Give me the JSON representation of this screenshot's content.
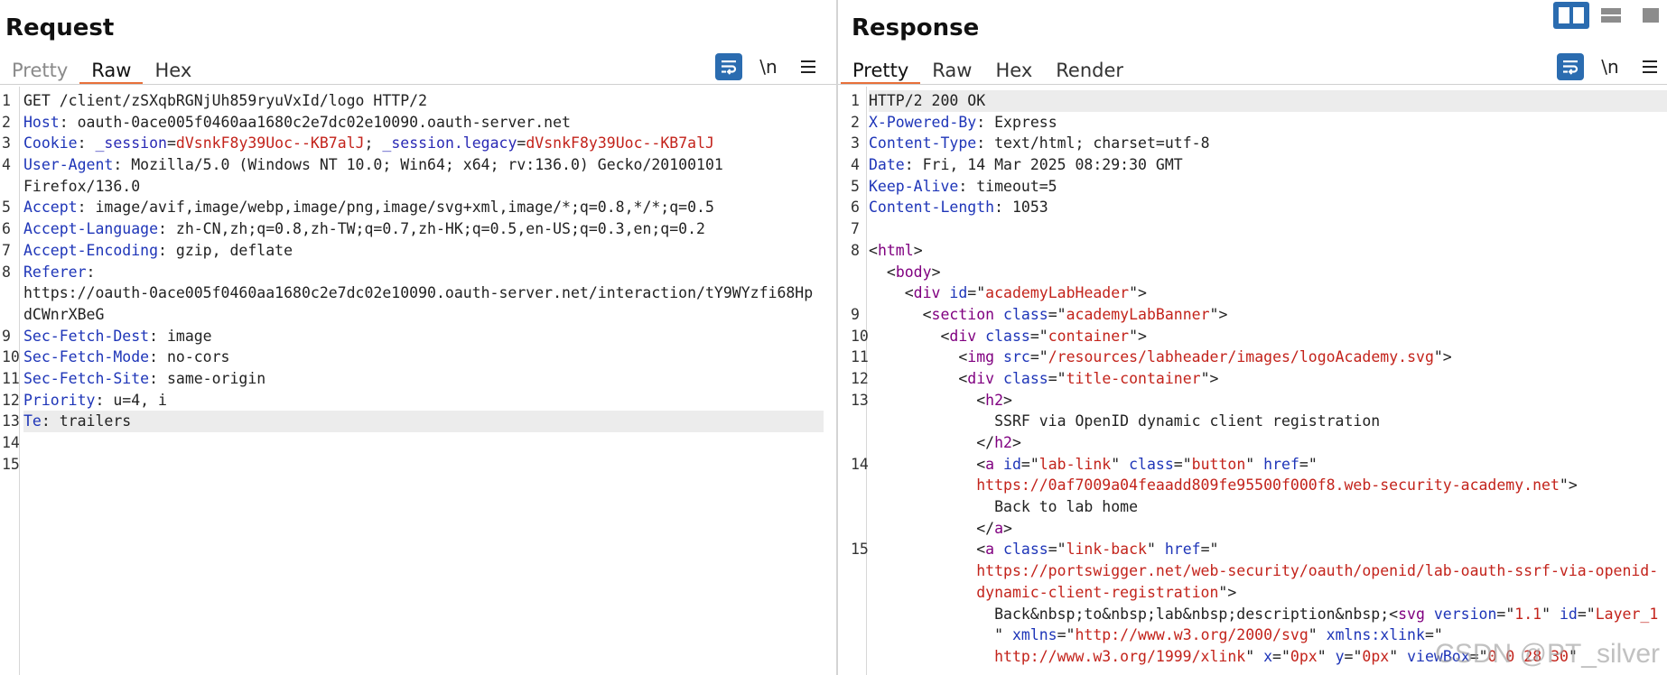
{
  "request": {
    "title": "Request",
    "tabs": [
      "Pretty",
      "Raw",
      "Hex"
    ],
    "active_tab": "Raw",
    "newline_toggle": "\\n",
    "lines": [
      {
        "n": "1",
        "parts": [
          {
            "c": "v",
            "t": "GET /client/zSXqbRGNjUh859ryuVxId/logo HTTP/2"
          }
        ]
      },
      {
        "n": "2",
        "parts": [
          {
            "c": "k",
            "t": "Host"
          },
          {
            "c": "v",
            "t": ": oauth-0ace005f0460aa1680c2e7dc02e10090.oauth-server.net"
          }
        ]
      },
      {
        "n": "3",
        "parts": [
          {
            "c": "k",
            "t": "Cookie"
          },
          {
            "c": "v",
            "t": ": "
          },
          {
            "c": "t",
            "t": "_session"
          },
          {
            "c": "v",
            "t": "="
          },
          {
            "c": "c",
            "t": "dVsnkF8y39Uoc--KB7alJ"
          },
          {
            "c": "v",
            "t": "; "
          },
          {
            "c": "t",
            "t": "_session.legacy"
          },
          {
            "c": "v",
            "t": "="
          },
          {
            "c": "c",
            "t": "dVsnkF8y39Uoc--KB7alJ"
          }
        ]
      },
      {
        "n": "4",
        "parts": [
          {
            "c": "k",
            "t": "User-Agent"
          },
          {
            "c": "v",
            "t": ": Mozilla/5.0 (Windows NT 10.0; Win64; x64; rv:136.0) Gecko/20100101"
          }
        ]
      },
      {
        "n": "",
        "parts": [
          {
            "c": "v",
            "t": "Firefox/136.0"
          }
        ]
      },
      {
        "n": "5",
        "parts": [
          {
            "c": "k",
            "t": "Accept"
          },
          {
            "c": "v",
            "t": ": image/avif,image/webp,image/png,image/svg+xml,image/*;q=0.8,*/*;q=0.5"
          }
        ]
      },
      {
        "n": "6",
        "parts": [
          {
            "c": "k",
            "t": "Accept-Language"
          },
          {
            "c": "v",
            "t": ": zh-CN,zh;q=0.8,zh-TW;q=0.7,zh-HK;q=0.5,en-US;q=0.3,en;q=0.2"
          }
        ]
      },
      {
        "n": "7",
        "parts": [
          {
            "c": "k",
            "t": "Accept-Encoding"
          },
          {
            "c": "v",
            "t": ": gzip, deflate"
          }
        ]
      },
      {
        "n": "8",
        "parts": [
          {
            "c": "k",
            "t": "Referer"
          },
          {
            "c": "v",
            "t": ":"
          }
        ]
      },
      {
        "n": "",
        "parts": [
          {
            "c": "v",
            "t": "https://oauth-0ace005f0460aa1680c2e7dc02e10090.oauth-server.net/interaction/tY9WYzfi68Hp"
          }
        ]
      },
      {
        "n": "",
        "parts": [
          {
            "c": "v",
            "t": "dCWnrXBeG"
          }
        ]
      },
      {
        "n": "9",
        "parts": [
          {
            "c": "k",
            "t": "Sec-Fetch-Dest"
          },
          {
            "c": "v",
            "t": ": image"
          }
        ]
      },
      {
        "n": "10",
        "parts": [
          {
            "c": "k",
            "t": "Sec-Fetch-Mode"
          },
          {
            "c": "v",
            "t": ": no-cors"
          }
        ]
      },
      {
        "n": "11",
        "parts": [
          {
            "c": "k",
            "t": "Sec-Fetch-Site"
          },
          {
            "c": "v",
            "t": ": same-origin"
          }
        ]
      },
      {
        "n": "12",
        "parts": [
          {
            "c": "k",
            "t": "Priority"
          },
          {
            "c": "v",
            "t": ": u=4, i"
          }
        ]
      },
      {
        "n": "13",
        "hl": true,
        "parts": [
          {
            "c": "k",
            "t": "Te"
          },
          {
            "c": "v",
            "t": ": trailers"
          }
        ]
      },
      {
        "n": "14",
        "parts": []
      },
      {
        "n": "15",
        "parts": []
      }
    ]
  },
  "response": {
    "title": "Response",
    "tabs": [
      "Pretty",
      "Raw",
      "Hex",
      "Render"
    ],
    "active_tab": "Pretty",
    "newline_toggle": "\\n",
    "lines": [
      {
        "n": "1",
        "hl": true,
        "parts": [
          {
            "c": "v",
            "t": "HTTP/2 200 OK"
          }
        ]
      },
      {
        "n": "2",
        "parts": [
          {
            "c": "k",
            "t": "X-Powered-By"
          },
          {
            "c": "v",
            "t": ": Express"
          }
        ]
      },
      {
        "n": "3",
        "parts": [
          {
            "c": "k",
            "t": "Content-Type"
          },
          {
            "c": "v",
            "t": ": text/html; charset=utf-8"
          }
        ]
      },
      {
        "n": "4",
        "parts": [
          {
            "c": "k",
            "t": "Date"
          },
          {
            "c": "v",
            "t": ": Fri, 14 Mar 2025 08:29:30 GMT"
          }
        ]
      },
      {
        "n": "5",
        "parts": [
          {
            "c": "k",
            "t": "Keep-Alive"
          },
          {
            "c": "v",
            "t": ": timeout=5"
          }
        ]
      },
      {
        "n": "6",
        "parts": [
          {
            "c": "k",
            "t": "Content-Length"
          },
          {
            "c": "v",
            "t": ": 1053"
          }
        ]
      },
      {
        "n": "7",
        "parts": []
      },
      {
        "n": "8",
        "parts": [
          {
            "c": "p",
            "t": "<"
          },
          {
            "c": "tg",
            "t": "html"
          },
          {
            "c": "p",
            "t": ">"
          }
        ]
      },
      {
        "n": "",
        "parts": [
          {
            "c": "p",
            "t": "  <"
          },
          {
            "c": "tg",
            "t": "body"
          },
          {
            "c": "p",
            "t": ">"
          }
        ]
      },
      {
        "n": "",
        "parts": [
          {
            "c": "p",
            "t": "    <"
          },
          {
            "c": "tg",
            "t": "div"
          },
          {
            "c": "a",
            "t": " id"
          },
          {
            "c": "p",
            "t": "=\""
          },
          {
            "c": "s",
            "t": "academyLabHeader"
          },
          {
            "c": "p",
            "t": "\">"
          }
        ]
      },
      {
        "n": "9",
        "parts": [
          {
            "c": "p",
            "t": "      <"
          },
          {
            "c": "tg",
            "t": "section"
          },
          {
            "c": "a",
            "t": " class"
          },
          {
            "c": "p",
            "t": "=\""
          },
          {
            "c": "s",
            "t": "academyLabBanner"
          },
          {
            "c": "p",
            "t": "\">"
          }
        ]
      },
      {
        "n": "10",
        "parts": [
          {
            "c": "p",
            "t": "        <"
          },
          {
            "c": "tg",
            "t": "div"
          },
          {
            "c": "a",
            "t": " class"
          },
          {
            "c": "p",
            "t": "=\""
          },
          {
            "c": "s",
            "t": "container"
          },
          {
            "c": "p",
            "t": "\">"
          }
        ]
      },
      {
        "n": "11",
        "parts": [
          {
            "c": "p",
            "t": "          <"
          },
          {
            "c": "tg",
            "t": "img"
          },
          {
            "c": "a",
            "t": " src"
          },
          {
            "c": "p",
            "t": "=\""
          },
          {
            "c": "s",
            "t": "/resources/labheader/images/logoAcademy.svg"
          },
          {
            "c": "p",
            "t": "\">"
          }
        ]
      },
      {
        "n": "12",
        "parts": [
          {
            "c": "p",
            "t": "          <"
          },
          {
            "c": "tg",
            "t": "div"
          },
          {
            "c": "a",
            "t": " class"
          },
          {
            "c": "p",
            "t": "=\""
          },
          {
            "c": "s",
            "t": "title-container"
          },
          {
            "c": "p",
            "t": "\">"
          }
        ]
      },
      {
        "n": "13",
        "parts": [
          {
            "c": "p",
            "t": "            <"
          },
          {
            "c": "tg",
            "t": "h2"
          },
          {
            "c": "p",
            "t": ">"
          }
        ]
      },
      {
        "n": "",
        "parts": [
          {
            "c": "v",
            "t": "              SSRF via OpenID dynamic client registration"
          }
        ]
      },
      {
        "n": "",
        "parts": [
          {
            "c": "p",
            "t": "            </"
          },
          {
            "c": "tg",
            "t": "h2"
          },
          {
            "c": "p",
            "t": ">"
          }
        ]
      },
      {
        "n": "14",
        "parts": [
          {
            "c": "p",
            "t": "            <"
          },
          {
            "c": "tg",
            "t": "a"
          },
          {
            "c": "a",
            "t": " id"
          },
          {
            "c": "p",
            "t": "=\""
          },
          {
            "c": "s",
            "t": "lab-link"
          },
          {
            "c": "p",
            "t": "\""
          },
          {
            "c": "a",
            "t": " class"
          },
          {
            "c": "p",
            "t": "=\""
          },
          {
            "c": "s",
            "t": "button"
          },
          {
            "c": "p",
            "t": "\""
          },
          {
            "c": "a",
            "t": " href"
          },
          {
            "c": "p",
            "t": "=\""
          }
        ]
      },
      {
        "n": "",
        "parts": [
          {
            "c": "s",
            "t": "            https://0af7009a04feaadd809fe95500f000f8.web-security-academy.net"
          },
          {
            "c": "p",
            "t": "\">"
          }
        ]
      },
      {
        "n": "",
        "parts": [
          {
            "c": "v",
            "t": "              Back to lab home"
          }
        ]
      },
      {
        "n": "",
        "parts": [
          {
            "c": "p",
            "t": "            </"
          },
          {
            "c": "tg",
            "t": "a"
          },
          {
            "c": "p",
            "t": ">"
          }
        ]
      },
      {
        "n": "15",
        "parts": [
          {
            "c": "p",
            "t": "            <"
          },
          {
            "c": "tg",
            "t": "a"
          },
          {
            "c": "a",
            "t": " class"
          },
          {
            "c": "p",
            "t": "=\""
          },
          {
            "c": "s",
            "t": "link-back"
          },
          {
            "c": "p",
            "t": "\""
          },
          {
            "c": "a",
            "t": " href"
          },
          {
            "c": "p",
            "t": "=\""
          }
        ]
      },
      {
        "n": "",
        "parts": [
          {
            "c": "s",
            "t": "            https://portswigger.net/web-security/oauth/openid/lab-oauth-ssrf-via-openid-"
          }
        ]
      },
      {
        "n": "",
        "parts": [
          {
            "c": "s",
            "t": "            dynamic-client-registration"
          },
          {
            "c": "p",
            "t": "\">"
          }
        ]
      },
      {
        "n": "",
        "parts": [
          {
            "c": "v",
            "t": "              Back&nbsp;to&nbsp;lab&nbsp;description&nbsp;"
          },
          {
            "c": "p",
            "t": "<"
          },
          {
            "c": "tg",
            "t": "svg"
          },
          {
            "c": "a",
            "t": " version"
          },
          {
            "c": "p",
            "t": "=\""
          },
          {
            "c": "s",
            "t": "1.1"
          },
          {
            "c": "p",
            "t": "\""
          },
          {
            "c": "a",
            "t": " id"
          },
          {
            "c": "p",
            "t": "=\""
          },
          {
            "c": "s",
            "t": "Layer_1"
          }
        ]
      },
      {
        "n": "",
        "parts": [
          {
            "c": "p",
            "t": "              \""
          },
          {
            "c": "a",
            "t": " xmlns"
          },
          {
            "c": "p",
            "t": "=\""
          },
          {
            "c": "s",
            "t": "http://www.w3.org/2000/svg"
          },
          {
            "c": "p",
            "t": "\""
          },
          {
            "c": "a",
            "t": " xmlns:xlink"
          },
          {
            "c": "p",
            "t": "=\""
          }
        ]
      },
      {
        "n": "",
        "parts": [
          {
            "c": "s",
            "t": "              http://www.w3.org/1999/xlink"
          },
          {
            "c": "p",
            "t": "\""
          },
          {
            "c": "a",
            "t": " x"
          },
          {
            "c": "p",
            "t": "=\""
          },
          {
            "c": "s",
            "t": "0px"
          },
          {
            "c": "p",
            "t": "\""
          },
          {
            "c": "a",
            "t": " y"
          },
          {
            "c": "p",
            "t": "=\""
          },
          {
            "c": "s",
            "t": "0px"
          },
          {
            "c": "p",
            "t": "\""
          },
          {
            "c": "a",
            "t": " viewBox"
          },
          {
            "c": "p",
            "t": "=\""
          },
          {
            "c": "s",
            "t": "0 0 28 30"
          },
          {
            "c": "p",
            "t": "\""
          }
        ]
      }
    ]
  },
  "layout_buttons": [
    {
      "name": "split-horizontal-layout-icon",
      "active": true
    },
    {
      "name": "split-vertical-layout-icon",
      "active": false
    },
    {
      "name": "single-pane-layout-icon",
      "active": false
    }
  ],
  "watermark": "CSDN @PT_silver",
  "colors": {
    "accent_tab_underline": "#e8703a",
    "active_button_blue": "#2b6cb0",
    "header_name_blue": "#1e35b8",
    "value_red": "#c3231b",
    "html_tag_purple": "#800080"
  }
}
